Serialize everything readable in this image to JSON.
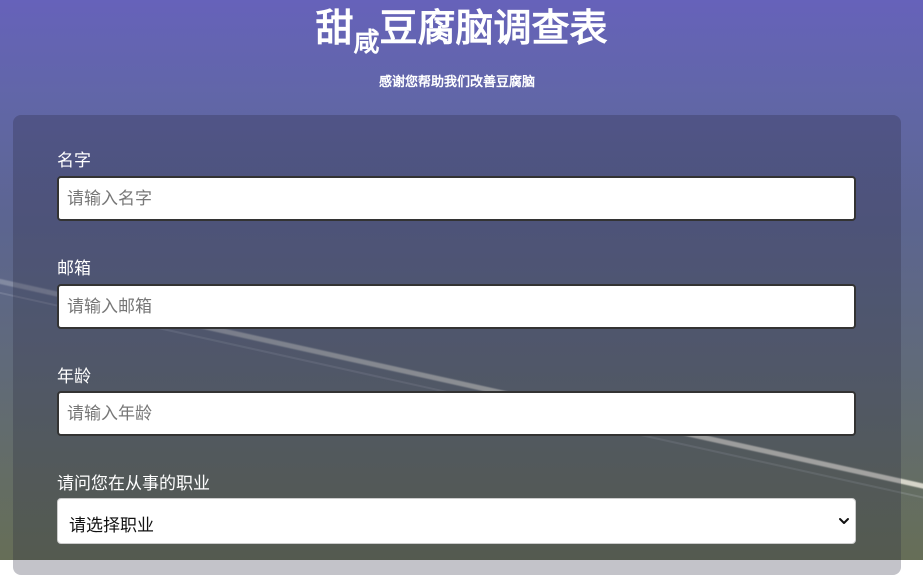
{
  "header": {
    "title_part1": "甜",
    "title_part2": "咸",
    "title_part3": "豆腐脑调查表",
    "subtitle": "感谢您帮助我们改善豆腐脑"
  },
  "form": {
    "name": {
      "label": "名字",
      "placeholder": "请输入名字",
      "value": ""
    },
    "email": {
      "label": "邮箱",
      "placeholder": "请输入邮箱",
      "value": ""
    },
    "age": {
      "label": "年龄",
      "placeholder": "请输入年龄",
      "value": ""
    },
    "job": {
      "label": "请问您在从事的职业",
      "selected": "请选择职业"
    }
  },
  "icons": {
    "dropdown": "chevron-down-icon"
  },
  "colors": {
    "text": "#ffffff",
    "input_border": "#333333",
    "input_bg": "#ffffff"
  }
}
